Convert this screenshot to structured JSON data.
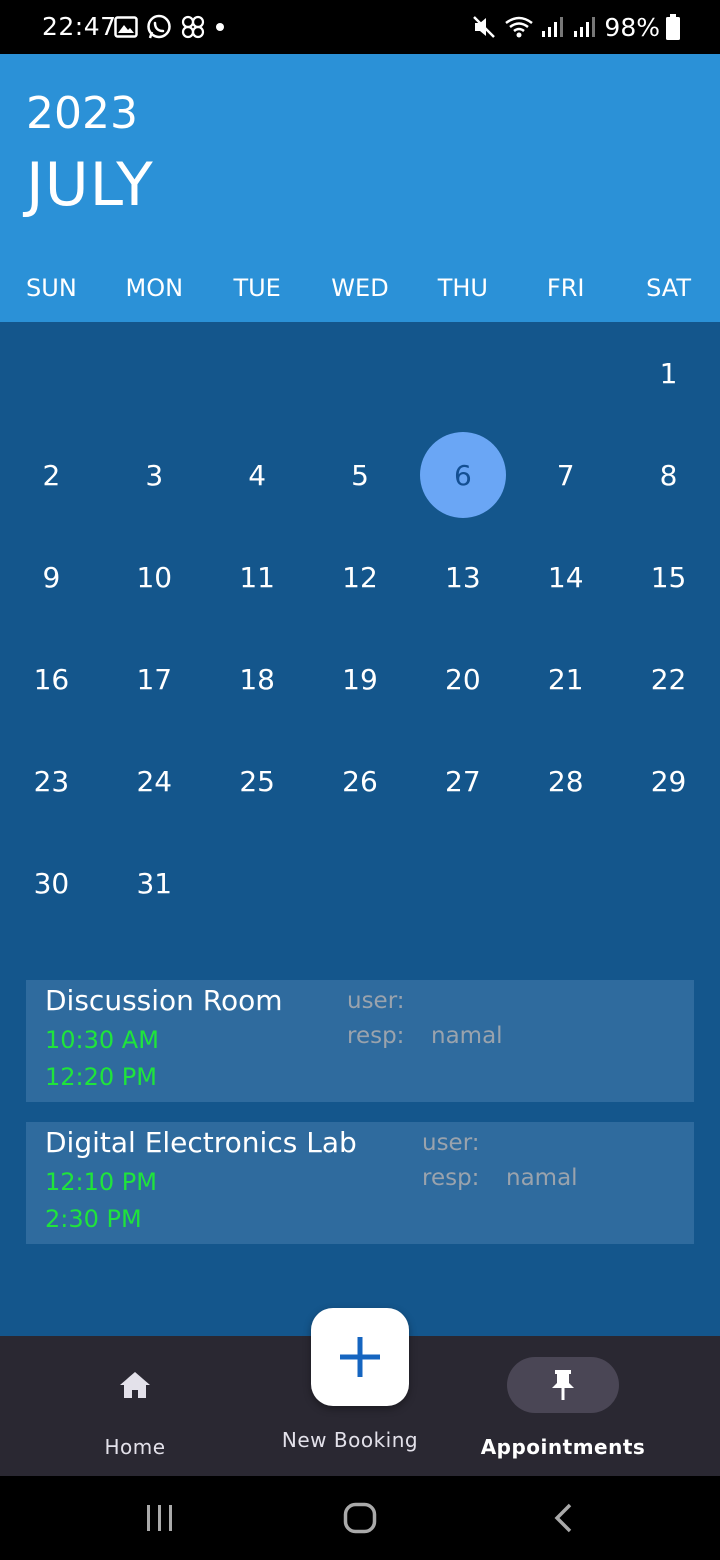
{
  "status_bar": {
    "time": "22:47",
    "battery": "98%"
  },
  "header": {
    "year": "2023",
    "month": "JULY",
    "weekdays": [
      "SUN",
      "MON",
      "TUE",
      "WED",
      "THU",
      "FRI",
      "SAT"
    ]
  },
  "calendar": {
    "leading_blanks": 6,
    "days": [
      "1",
      "2",
      "3",
      "4",
      "5",
      "6",
      "7",
      "8",
      "9",
      "10",
      "11",
      "12",
      "13",
      "14",
      "15",
      "16",
      "17",
      "18",
      "19",
      "20",
      "21",
      "22",
      "23",
      "24",
      "25",
      "26",
      "27",
      "28",
      "29",
      "30",
      "31"
    ],
    "selected_day": "6",
    "selected_color": "#6aa6f5"
  },
  "appointments": [
    {
      "title": "Discussion Room",
      "start": "10:30 AM",
      "end": "12:20 PM",
      "user_label": "user:",
      "user_value": "",
      "resp_label": "resp:",
      "resp_value": "namal"
    },
    {
      "title": "Digital Electronics Lab",
      "start": "12:10 PM",
      "end": "2:30 PM",
      "user_label": "user:",
      "user_value": "",
      "resp_label": "resp:",
      "resp_value": "namal"
    }
  ],
  "bottom_nav": {
    "home_label": "Home",
    "new_booking_label": "New Booking",
    "appointments_label": "Appointments",
    "active": "appointments"
  },
  "colors": {
    "header": "#2b91d7",
    "body": "#14568c",
    "card": "#2f6b9e",
    "time_green": "#1fe43b",
    "nav_bg": "#2a2832"
  }
}
